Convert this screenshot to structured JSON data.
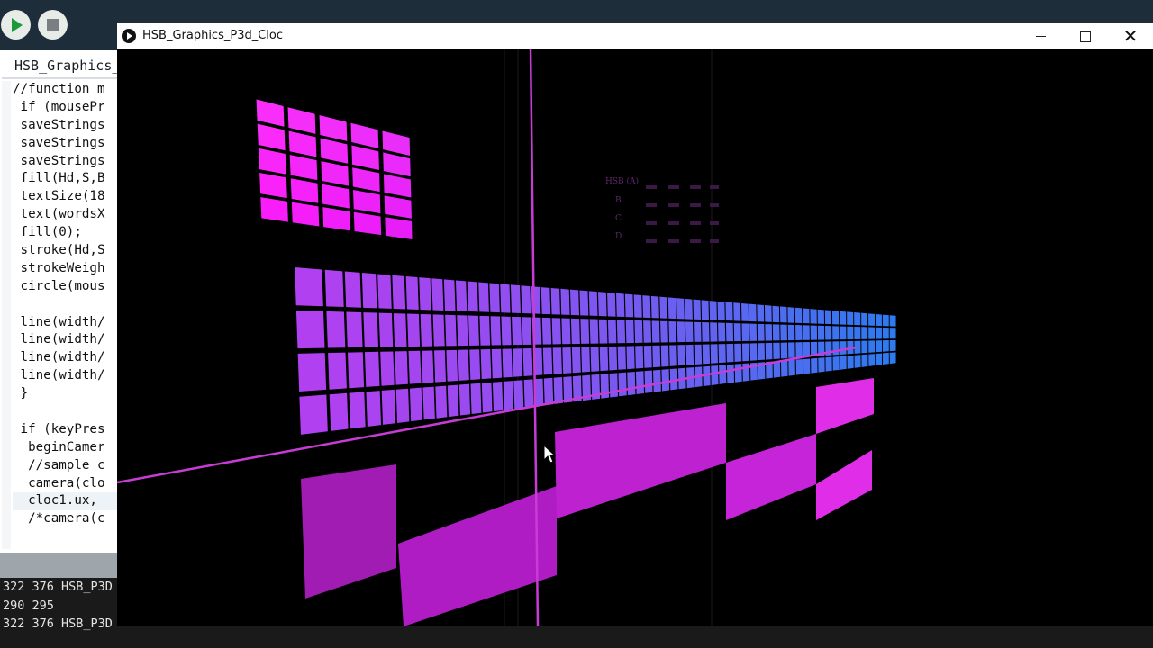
{
  "ide": {
    "run_label": "Run",
    "stop_label": "Stop",
    "tab_title": "HSB_Graphics_",
    "code_lines": [
      "//function m",
      " if (mousePr",
      " saveStrings",
      " saveStrings",
      " saveStrings",
      " fill(Hd,S,B",
      " textSize(18",
      " text(wordsX",
      " fill(0);",
      " stroke(Hd,S",
      " strokeWeigh",
      " circle(mous",
      "",
      " line(width/",
      " line(width/",
      " line(width/",
      " line(width/",
      " }",
      "",
      " if (keyPres",
      "  beginCamer",
      "  //sample c",
      "  camera(clo",
      "  cloc1.ux,",
      "  /*camera(c"
    ],
    "console_lines": [
      "322 376 HSB_P3D",
      "290 295",
      "322 376 HSB_P3D"
    ]
  },
  "window": {
    "title": "HSB_Graphics_P3d_Cloc",
    "minimize_label": "Minimize",
    "maximize_label": "Maximize",
    "close_label": "Close"
  },
  "sketch": {
    "hsb_table": {
      "header": "HSB (A)",
      "row_labels": [
        "B",
        "C",
        "D"
      ]
    },
    "colors": {
      "background": "#000000",
      "axis": "#c83cd6",
      "magenta_grid": "#f02ef0",
      "gradient_start": "#b040f0",
      "gradient_end": "#2b7cf0",
      "checker": "#b020c0"
    }
  }
}
